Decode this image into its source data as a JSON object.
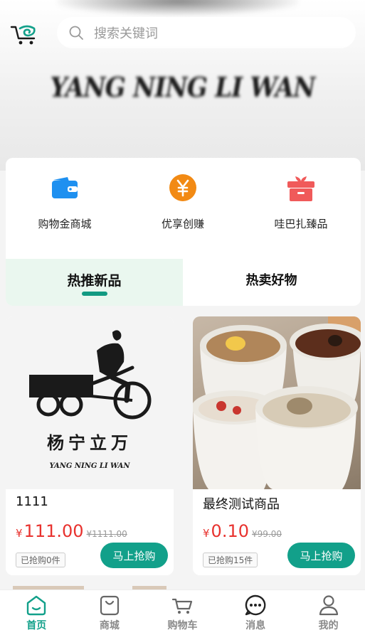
{
  "header": {
    "banner_text": "YANG NING LI WAN",
    "search_placeholder": "搜索关键词"
  },
  "menu": [
    {
      "label": "购物金商城",
      "icon": "wallet-icon",
      "color": "#1e90f0"
    },
    {
      "label": "优享创赚",
      "icon": "yen-coin-icon",
      "color": "#f28a14"
    },
    {
      "label": "哇巴扎臻品",
      "icon": "gift-box-icon",
      "color": "#f05a5a"
    }
  ],
  "tabs": [
    {
      "label": "热推新品",
      "active": true
    },
    {
      "label": "热卖好物",
      "active": false
    }
  ],
  "products": [
    {
      "name": "1111",
      "currency": "¥",
      "price": "111.00",
      "original_price": "¥1111.00",
      "sold": "已抢购0件",
      "buy_label": "马上抢购",
      "image": "tricycle-logo",
      "logo_cn": "杨宁立万",
      "logo_en": "YANG NING  LI WAN"
    },
    {
      "name": "最终测试商品",
      "currency": "¥",
      "price": "0.10",
      "original_price": "¥99.00",
      "sold": "已抢购15件",
      "buy_label": "马上抢购",
      "image": "soup-bowls-photo"
    }
  ],
  "tabbar": [
    {
      "label": "首页",
      "icon": "home-icon",
      "active": true
    },
    {
      "label": "商城",
      "icon": "shopping-bag-icon",
      "active": false
    },
    {
      "label": "购物车",
      "icon": "cart-icon",
      "active": false
    },
    {
      "label": "消息",
      "icon": "message-icon",
      "active": false
    },
    {
      "label": "我的",
      "icon": "user-icon",
      "active": false
    }
  ],
  "colors": {
    "accent": "#12a08a",
    "price": "#e8322e"
  }
}
